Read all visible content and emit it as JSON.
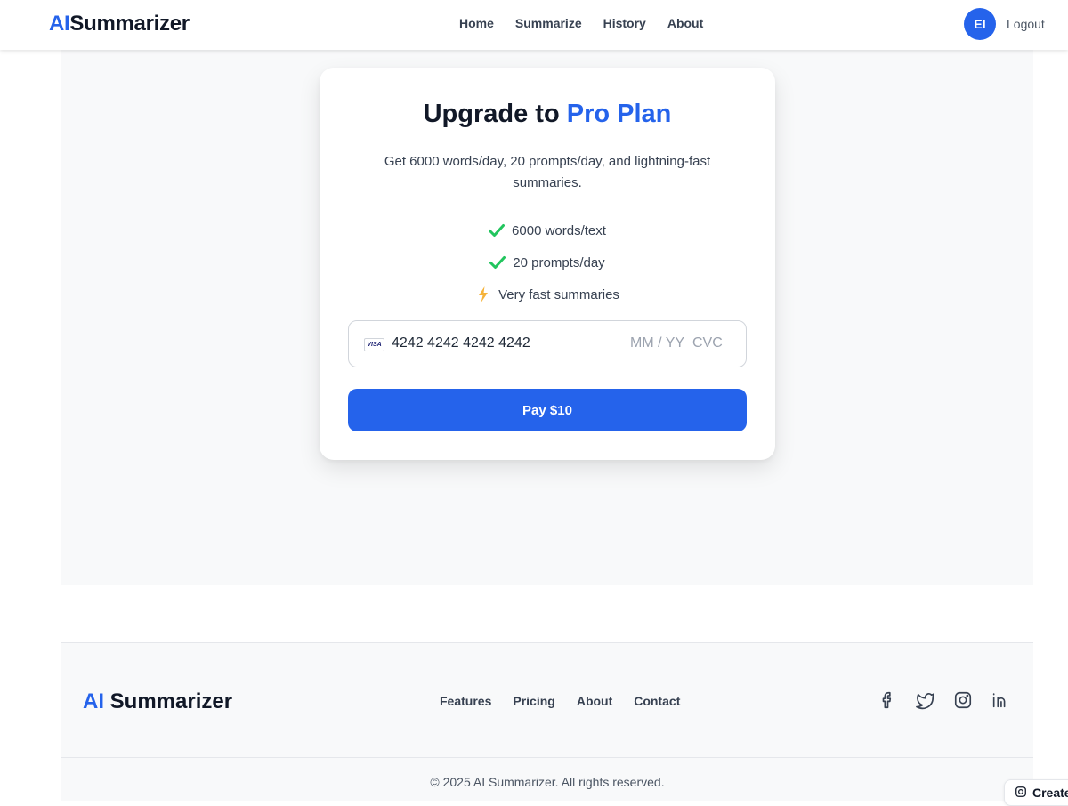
{
  "navbar": {
    "brand_ai": "AI",
    "brand_rest": "Summarizer",
    "links": [
      "Home",
      "Summarize",
      "History",
      "About"
    ],
    "avatar_initials": "EI",
    "logout_label": "Logout"
  },
  "upgrade": {
    "title_prefix": "Upgrade to ",
    "title_accent": "Pro Plan",
    "description": "Get 6000 words/day, 20 prompts/day, and lightning-fast summaries.",
    "features": [
      {
        "icon": "check-icon",
        "text": "6000 words/text"
      },
      {
        "icon": "check-icon",
        "text": "20 prompts/day"
      },
      {
        "icon": "lightning-icon",
        "text": "Very fast summaries"
      }
    ],
    "card_brand": "VISA",
    "card_number": "4242 4242 4242 4242",
    "expiry_placeholder": "MM / YY",
    "cvc_placeholder": "CVC",
    "pay_label": "Pay $10"
  },
  "footer": {
    "brand_ai": "AI",
    "brand_rest": "Summarizer",
    "links": [
      "Features",
      "Pricing",
      "About",
      "Contact"
    ],
    "socials": [
      "facebook-icon",
      "twitter-icon",
      "instagram-icon",
      "linkedin-icon"
    ],
    "copyright": "© 2025 AI Summarizer. All rights reserved."
  },
  "create_chip": {
    "label": "Create"
  },
  "colors": {
    "accent": "#2563eb",
    "check": "#22c55e",
    "lightning": "#f5b33b",
    "page_bg": "#f8f9fa"
  }
}
